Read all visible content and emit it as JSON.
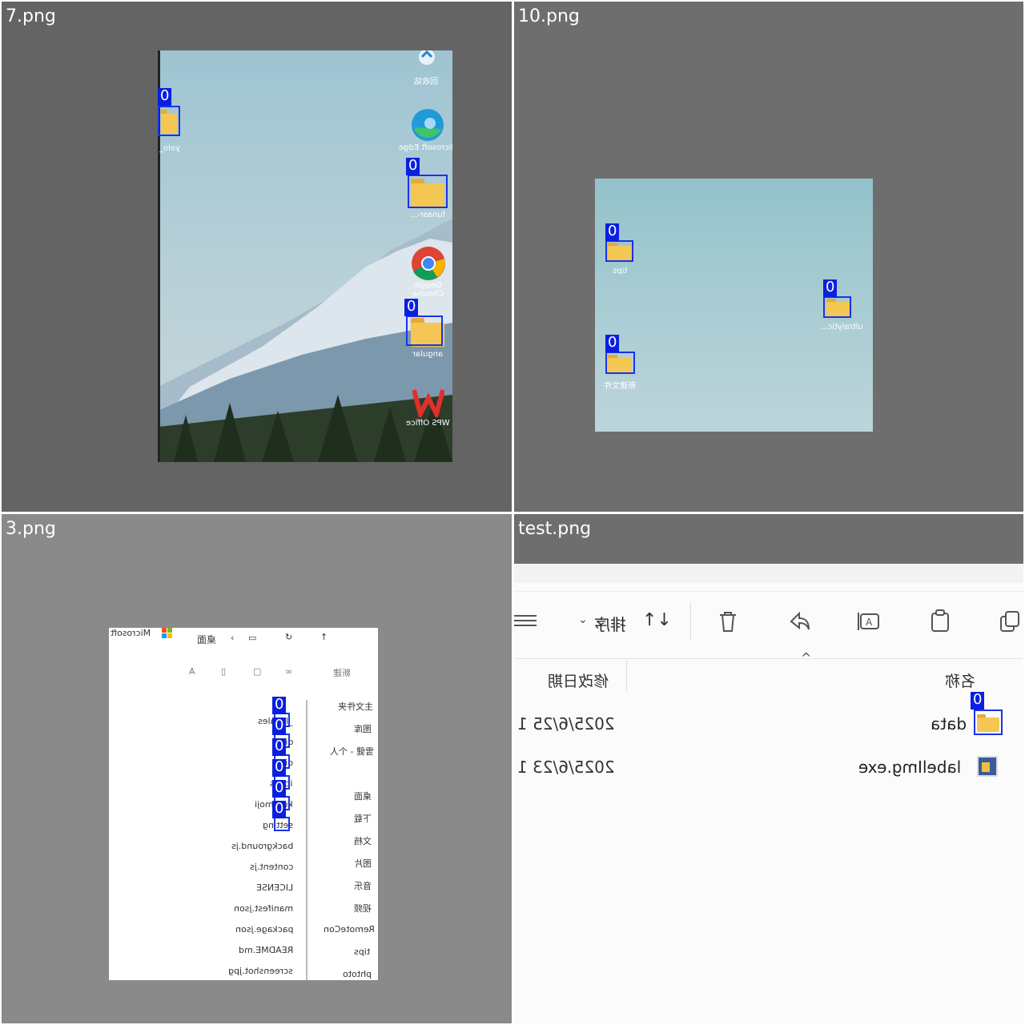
{
  "tiles": {
    "t7": {
      "title": "7.png",
      "bg": "#646464",
      "icons": {
        "recycle": "回收站",
        "edge": "Microsoft Edge",
        "folder1": "funasr-...",
        "chrome": "Google Chrome",
        "folder2": "angular",
        "wps": "WPS Office",
        "left_folder": "yolo_"
      },
      "detections": [
        "0",
        "0",
        "0"
      ]
    },
    "t10": {
      "title": "10.png",
      "bg": "#6e6e6e",
      "icons": {
        "tips": "tips",
        "ultralytics": "ultralytic...",
        "third": "新建文件"
      },
      "detections": [
        "0",
        "0",
        "0"
      ]
    },
    "t3": {
      "title": "3.png",
      "bg": "#8a8a8a",
      "window_title": "Microsoft",
      "path": "桌面",
      "new_btn": "新建",
      "nav": [
        "主文件夹",
        "图库",
        "雪健 - 个人",
        "桌面",
        "下载",
        "文档",
        "图片",
        "音乐",
        "视频",
        "RemoteCon",
        "tips",
        "phtoto"
      ],
      "files": [
        "_locales",
        "dict",
        "dist",
        "icons",
        "kuromoji",
        "setting",
        "background.js",
        "content.js",
        "LICENSE",
        "manifest.json",
        "package.json",
        "README.md",
        "screenshot.jpg"
      ],
      "detections": [
        "0",
        "0",
        "0",
        "0",
        "0",
        "0"
      ]
    },
    "tt": {
      "title": "test.png",
      "bg": "#6e6e6e",
      "sort_label": "排序",
      "col_name": "名称",
      "col_date": "修改日期",
      "rows": [
        {
          "name": "data",
          "date": "2025/6/25 1"
        },
        {
          "name": "labelImg.exe",
          "date": "2025/6/23 1"
        }
      ],
      "detections": [
        "0"
      ]
    }
  },
  "colors": {
    "box": "#1a33e6",
    "tag": "#0a1fe0",
    "folder": "#f4c653"
  }
}
